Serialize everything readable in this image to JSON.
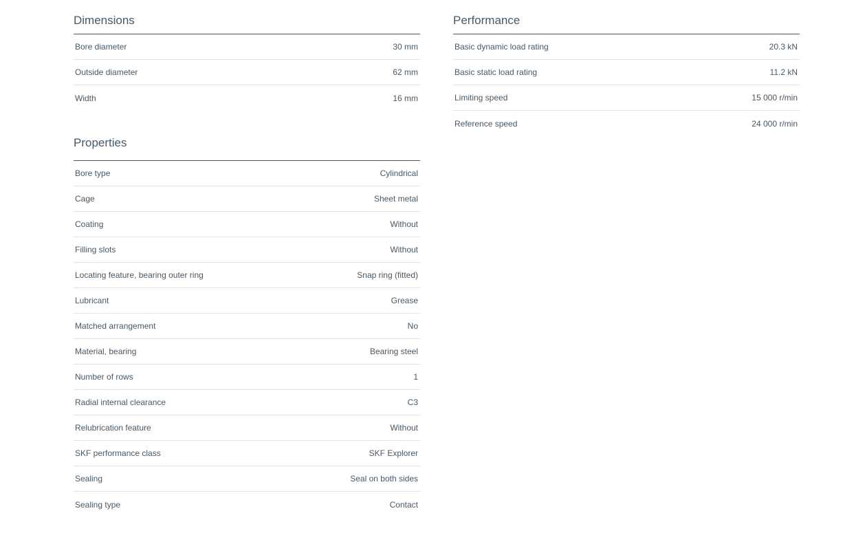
{
  "dimensions": {
    "title": "Dimensions",
    "rows": [
      {
        "label": "Bore diameter",
        "value": "30 mm"
      },
      {
        "label": "Outside diameter",
        "value": "62 mm"
      },
      {
        "label": "Width",
        "value": "16 mm"
      }
    ]
  },
  "performance": {
    "title": "Performance",
    "rows": [
      {
        "label": "Basic dynamic load rating",
        "value": "20.3 kN"
      },
      {
        "label": "Basic static load rating",
        "value": "11.2 kN"
      },
      {
        "label": "Limiting speed",
        "value": "15 000 r/min"
      },
      {
        "label": "Reference speed",
        "value": "24 000 r/min"
      }
    ]
  },
  "properties": {
    "title": "Properties",
    "rows": [
      {
        "label": "Bore type",
        "value": "Cylindrical"
      },
      {
        "label": "Cage",
        "value": "Sheet metal"
      },
      {
        "label": "Coating",
        "value": "Without"
      },
      {
        "label": "Filling slots",
        "value": "Without"
      },
      {
        "label": "Locating feature, bearing outer ring",
        "value": "Snap ring (fitted)"
      },
      {
        "label": "Lubricant",
        "value": "Grease"
      },
      {
        "label": "Matched arrangement",
        "value": "No"
      },
      {
        "label": "Material, bearing",
        "value": "Bearing steel"
      },
      {
        "label": "Number of rows",
        "value": "1"
      },
      {
        "label": "Radial internal clearance",
        "value": "C3"
      },
      {
        "label": "Relubrication feature",
        "value": "Without"
      },
      {
        "label": "SKF performance class",
        "value": "SKF Explorer"
      },
      {
        "label": "Sealing",
        "value": "Seal on both sides"
      },
      {
        "label": "Sealing type",
        "value": "Contact"
      }
    ]
  }
}
